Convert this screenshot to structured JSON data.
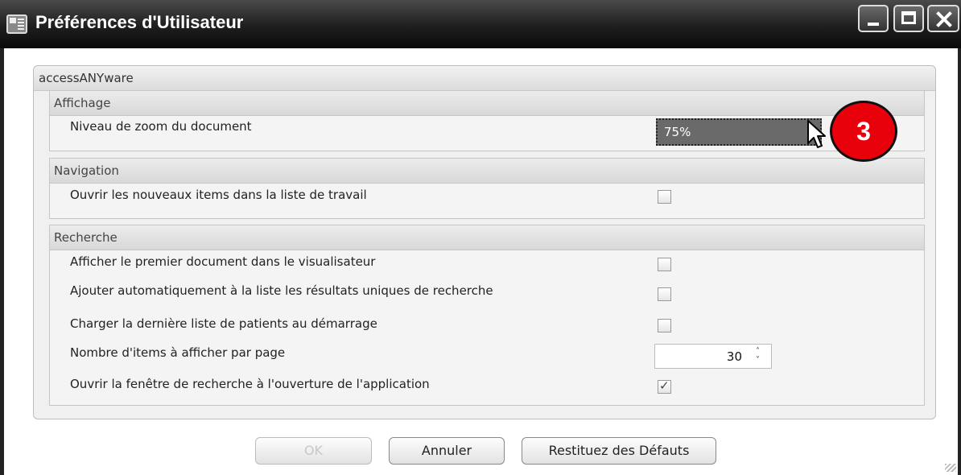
{
  "window": {
    "title": "Préférences d'Utilisateur"
  },
  "panel": {
    "title": "accessANYware"
  },
  "sections": {
    "affichage": {
      "title": "Affichage",
      "zoom_label": "Niveau de zoom du document",
      "zoom_value": "75%"
    },
    "navigation": {
      "title": "Navigation",
      "open_items_label": "Ouvrir les nouveaux items dans la liste de travail",
      "open_items_checked": false
    },
    "recherche": {
      "title": "Recherche",
      "items": [
        {
          "label": "Afficher le premier document dans le visualisateur",
          "checked": false
        },
        {
          "label": "Ajouter automatiquement à la liste les résultats uniques de recherche",
          "checked": false
        },
        {
          "label": "Charger la dernière liste de patients au démarrage",
          "checked": false
        },
        {
          "label": "Nombre d'items à afficher par page",
          "value": "30"
        },
        {
          "label": "Ouvrir la fenêtre de recherche à l'ouverture de l'application",
          "checked": true
        }
      ]
    }
  },
  "buttons": {
    "ok": "OK",
    "cancel": "Annuler",
    "restore": "Restituez des Défauts"
  },
  "annotation": {
    "badge": "3",
    "color": "#e8000b"
  }
}
